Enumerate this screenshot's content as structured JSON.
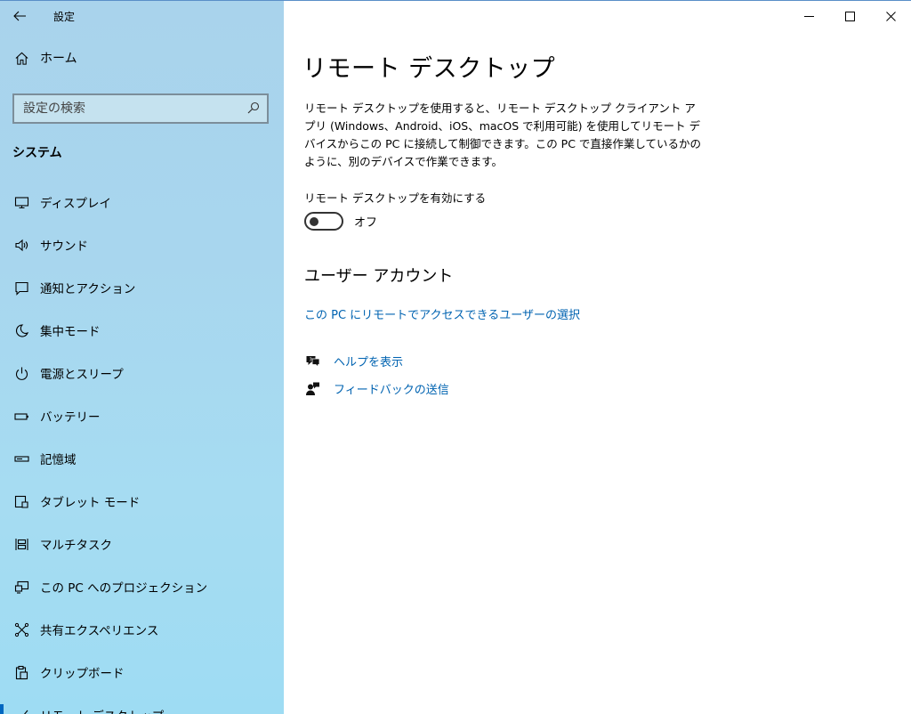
{
  "app": {
    "title": "設定"
  },
  "sidebar": {
    "home_label": "ホーム",
    "search_placeholder": "設定の検索",
    "section": "システム",
    "items": [
      {
        "label": "ディスプレイ",
        "icon": "monitor-icon"
      },
      {
        "label": "サウンド",
        "icon": "speaker-icon"
      },
      {
        "label": "通知とアクション",
        "icon": "notification-icon"
      },
      {
        "label": "集中モード",
        "icon": "moon-icon"
      },
      {
        "label": "電源とスリープ",
        "icon": "power-icon"
      },
      {
        "label": "バッテリー",
        "icon": "battery-icon"
      },
      {
        "label": "記憶域",
        "icon": "storage-icon"
      },
      {
        "label": "タブレット モード",
        "icon": "tablet-icon"
      },
      {
        "label": "マルチタスク",
        "icon": "multitask-icon"
      },
      {
        "label": "この PC へのプロジェクション",
        "icon": "projection-icon"
      },
      {
        "label": "共有エクスペリエンス",
        "icon": "shared-icon"
      },
      {
        "label": "クリップボード",
        "icon": "clipboard-icon"
      },
      {
        "label": "リモート デスクトップ",
        "icon": "remote-desktop-icon"
      }
    ]
  },
  "main": {
    "title": "リモート デスクトップ",
    "description": "リモート デスクトップを使用すると、リモート デスクトップ クライアント アプリ (Windows、Android、iOS、macOS で利用可能) を使用してリモート デバイスからこの PC に接続して制御できます。この PC で直接作業しているかのように、別のデバイスで作業できます。",
    "toggle_label": "リモート デスクトップを有効にする",
    "toggle_state": "オフ",
    "toggle_on": false,
    "user_accounts_title": "ユーザー アカウント",
    "users_link": "この PC にリモートでアクセスできるユーザーの選択",
    "help_link": "ヘルプを表示",
    "feedback_link": "フィードバックの送信"
  },
  "colors": {
    "accent": "#0067c0",
    "link": "#0063b1"
  }
}
